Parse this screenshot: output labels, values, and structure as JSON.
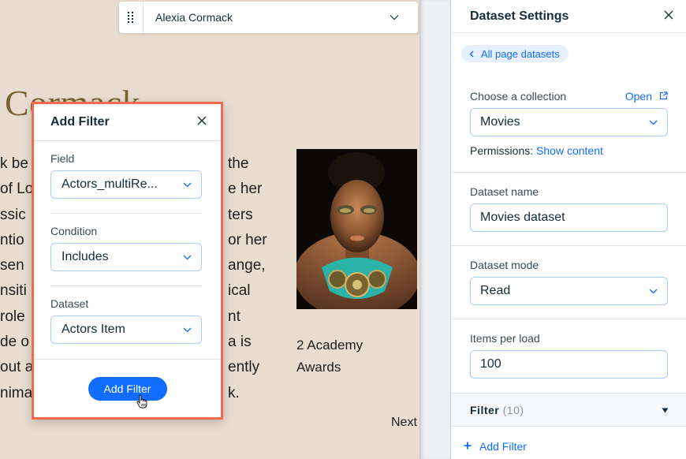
{
  "canvas": {
    "item_selector": {
      "value": "Alexia Cormack"
    },
    "hero_title": "Cormack",
    "bio_lines": [
      {
        "left": "k be",
        "right": "the"
      },
      {
        "left": "of Lo",
        "right": "e her"
      },
      {
        "left": "ssic",
        "right": "ters"
      },
      {
        "left": "ntio",
        "right": "or her"
      },
      {
        "left": "sen",
        "right": "ange,"
      },
      {
        "left": "nsiti",
        "right": "ical"
      },
      {
        "left": " role",
        "right": "nt"
      },
      {
        "left": "de o",
        "right": "a is"
      },
      {
        "left": "out a",
        "right": "ently"
      },
      {
        "left": "nima",
        "right": "k."
      }
    ],
    "awards_text": "2 Academy Awards",
    "next_label": "Next"
  },
  "add_filter_popup": {
    "title": "Add Filter",
    "field": {
      "label": "Field",
      "value": "Actors_multiRe..."
    },
    "condition": {
      "label": "Condition",
      "value": "Includes"
    },
    "dataset": {
      "label": "Dataset",
      "value": "Actors Item"
    },
    "submit_label": "Add Filter"
  },
  "dataset_settings": {
    "title": "Dataset Settings",
    "breadcrumb": "All page datasets",
    "collection": {
      "label": "Choose a collection",
      "open_label": "Open",
      "value": "Movies",
      "permissions_label": "Permissions:",
      "permissions_link": "Show content"
    },
    "dataset_name": {
      "label": "Dataset name",
      "value": "Movies dataset"
    },
    "dataset_mode": {
      "label": "Dataset mode",
      "value": "Read"
    },
    "items_per_load": {
      "label": "Items per load",
      "value": "100"
    },
    "filter": {
      "label": "Filter",
      "count": "(10)"
    },
    "add_filter_label": "Add Filter"
  },
  "colors": {
    "accent": "#116dff",
    "popup_border": "#f26b4f",
    "canvas_bg": "#e8ddd0",
    "title_gold": "#7a6530"
  }
}
